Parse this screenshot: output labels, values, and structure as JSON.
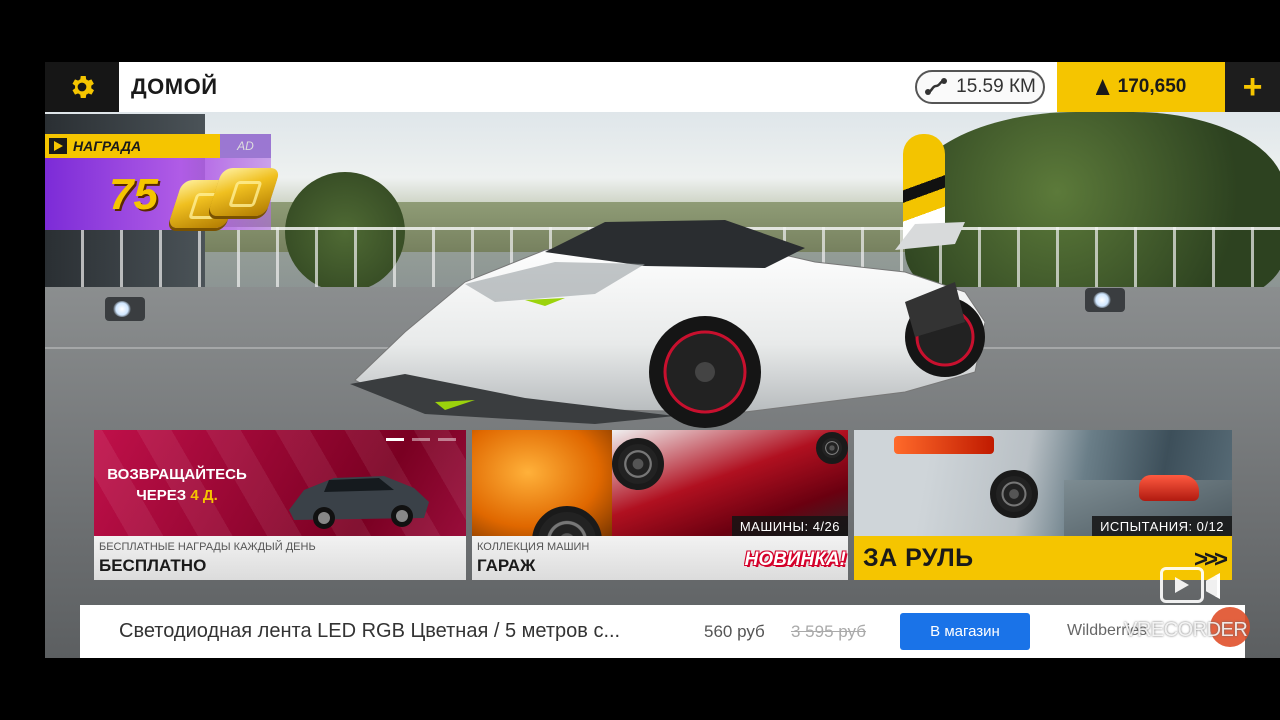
{
  "topbar": {
    "title": "ДОМОЙ",
    "distance": "15.59 КМ",
    "currency": "170,650",
    "plus": "+"
  },
  "reward": {
    "title": "НАГРАДА",
    "ad_tag": "AD",
    "amount": "75"
  },
  "cards": {
    "daily": {
      "message_line1": "ВОЗВРАЩАЙТЕСЬ",
      "message_pre": "ЧЕРЕЗ ",
      "message_days": "4 Д.",
      "subtitle": "БЕСПЛАТНЫЕ НАГРАДЫ КАЖДЫЙ ДЕНЬ",
      "title": "БЕСПЛАТНО"
    },
    "garage": {
      "count": "МАШИНЫ: 4/26",
      "subtitle": "КОЛЛЕКЦИЯ МАШИН",
      "title": "ГАРАЖ",
      "badge": "НОВИНКА!"
    },
    "drive": {
      "count": "ИСПЫТАНИЯ: 0/12",
      "title": "ЗА РУЛЬ",
      "chevrons": ">>>"
    }
  },
  "ad": {
    "title": "Светодиодная лента LED RGB Цветная / 5 метров с...",
    "price": "560 руб",
    "old_price": "3 595 руб",
    "button": "В магазин",
    "brand": "Wildberries"
  },
  "watermark": {
    "text": "VRECORDER"
  },
  "colors": {
    "accent": "#f5c500",
    "reward_purple": "#7c2bd7",
    "daily_red": "#c0104a",
    "ad_button": "#1a73e8"
  }
}
